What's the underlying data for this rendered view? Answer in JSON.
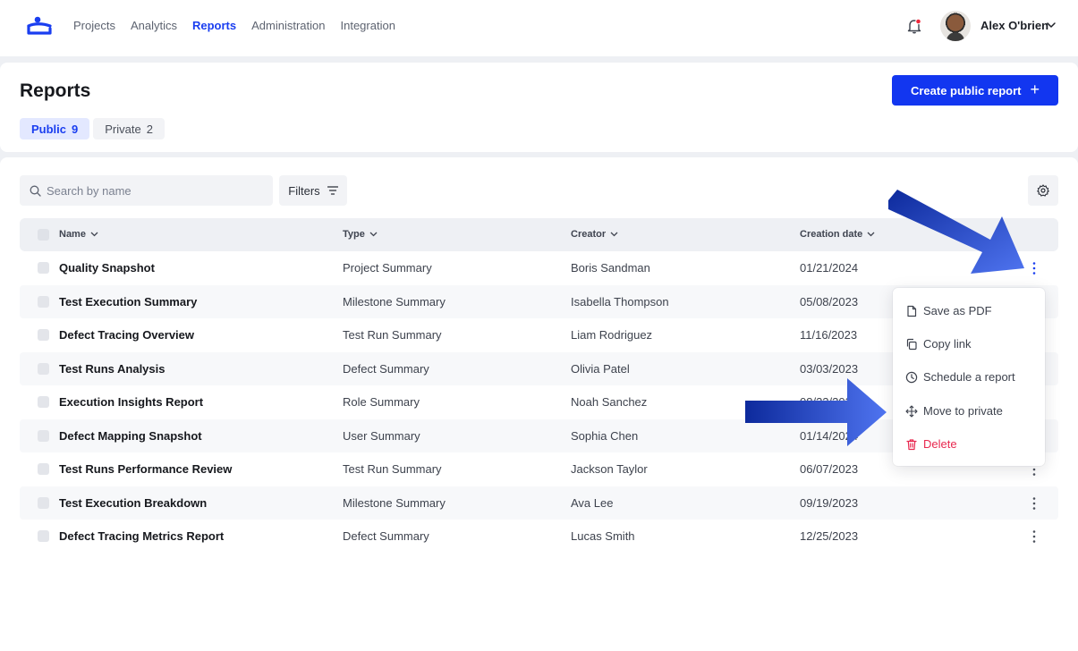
{
  "nav": {
    "items": [
      {
        "label": "Projects",
        "active": false
      },
      {
        "label": "Analytics",
        "active": false
      },
      {
        "label": "Reports",
        "active": true
      },
      {
        "label": "Administration",
        "active": false
      },
      {
        "label": "Integration",
        "active": false
      }
    ],
    "user_name": "Alex O'brien",
    "notification_dot_color": "#f0283c"
  },
  "header": {
    "title": "Reports",
    "create_button": "Create public report",
    "tabs": [
      {
        "label": "Public",
        "count": "9",
        "active": true
      },
      {
        "label": "Private",
        "count": "2",
        "active": false
      }
    ]
  },
  "toolbar": {
    "search_placeholder": "Search by name",
    "filters_label": "Filters"
  },
  "table": {
    "columns": [
      "Name",
      "Type",
      "Creator",
      "Creation date"
    ],
    "rows": [
      {
        "name": "Quality Snapshot",
        "type": "Project Summary",
        "creator": "Boris Sandman",
        "date": "01/21/2024"
      },
      {
        "name": "Test Execution Summary",
        "type": "Milestone Summary",
        "creator": "Isabella Thompson",
        "date": "05/08/2023"
      },
      {
        "name": "Defect Tracing Overview",
        "type": "Test Run Summary",
        "creator": "Liam Rodriguez",
        "date": "11/16/2023"
      },
      {
        "name": "Test Runs Analysis",
        "type": "Defect Summary",
        "creator": "Olivia Patel",
        "date": "03/03/2023"
      },
      {
        "name": "Execution Insights Report",
        "type": "Role Summary",
        "creator": "Noah Sanchez",
        "date": "08/22/2023"
      },
      {
        "name": "Defect Mapping Snapshot",
        "type": "User Summary",
        "creator": "Sophia Chen",
        "date": "01/14/2024"
      },
      {
        "name": "Test Runs Performance Review",
        "type": "Test Run Summary",
        "creator": "Jackson Taylor",
        "date": "06/07/2023"
      },
      {
        "name": "Test Execution Breakdown",
        "type": "Milestone Summary",
        "creator": "Ava Lee",
        "date": "09/19/2023"
      },
      {
        "name": "Defect Tracing Metrics Report",
        "type": "Defect Summary",
        "creator": "Lucas Smith",
        "date": "12/25/2023"
      }
    ]
  },
  "menu": {
    "items": [
      {
        "label": "Save as PDF",
        "icon": "file-icon"
      },
      {
        "label": "Copy link",
        "icon": "copy-icon"
      },
      {
        "label": "Schedule a report",
        "icon": "clock-icon"
      },
      {
        "label": "Move to private",
        "icon": "move-icon"
      },
      {
        "label": "Delete",
        "icon": "trash-icon",
        "danger": true
      }
    ]
  },
  "colors": {
    "accent": "#1236f0",
    "danger": "#e8284f",
    "annotation_arrow": "#2f55e6"
  }
}
